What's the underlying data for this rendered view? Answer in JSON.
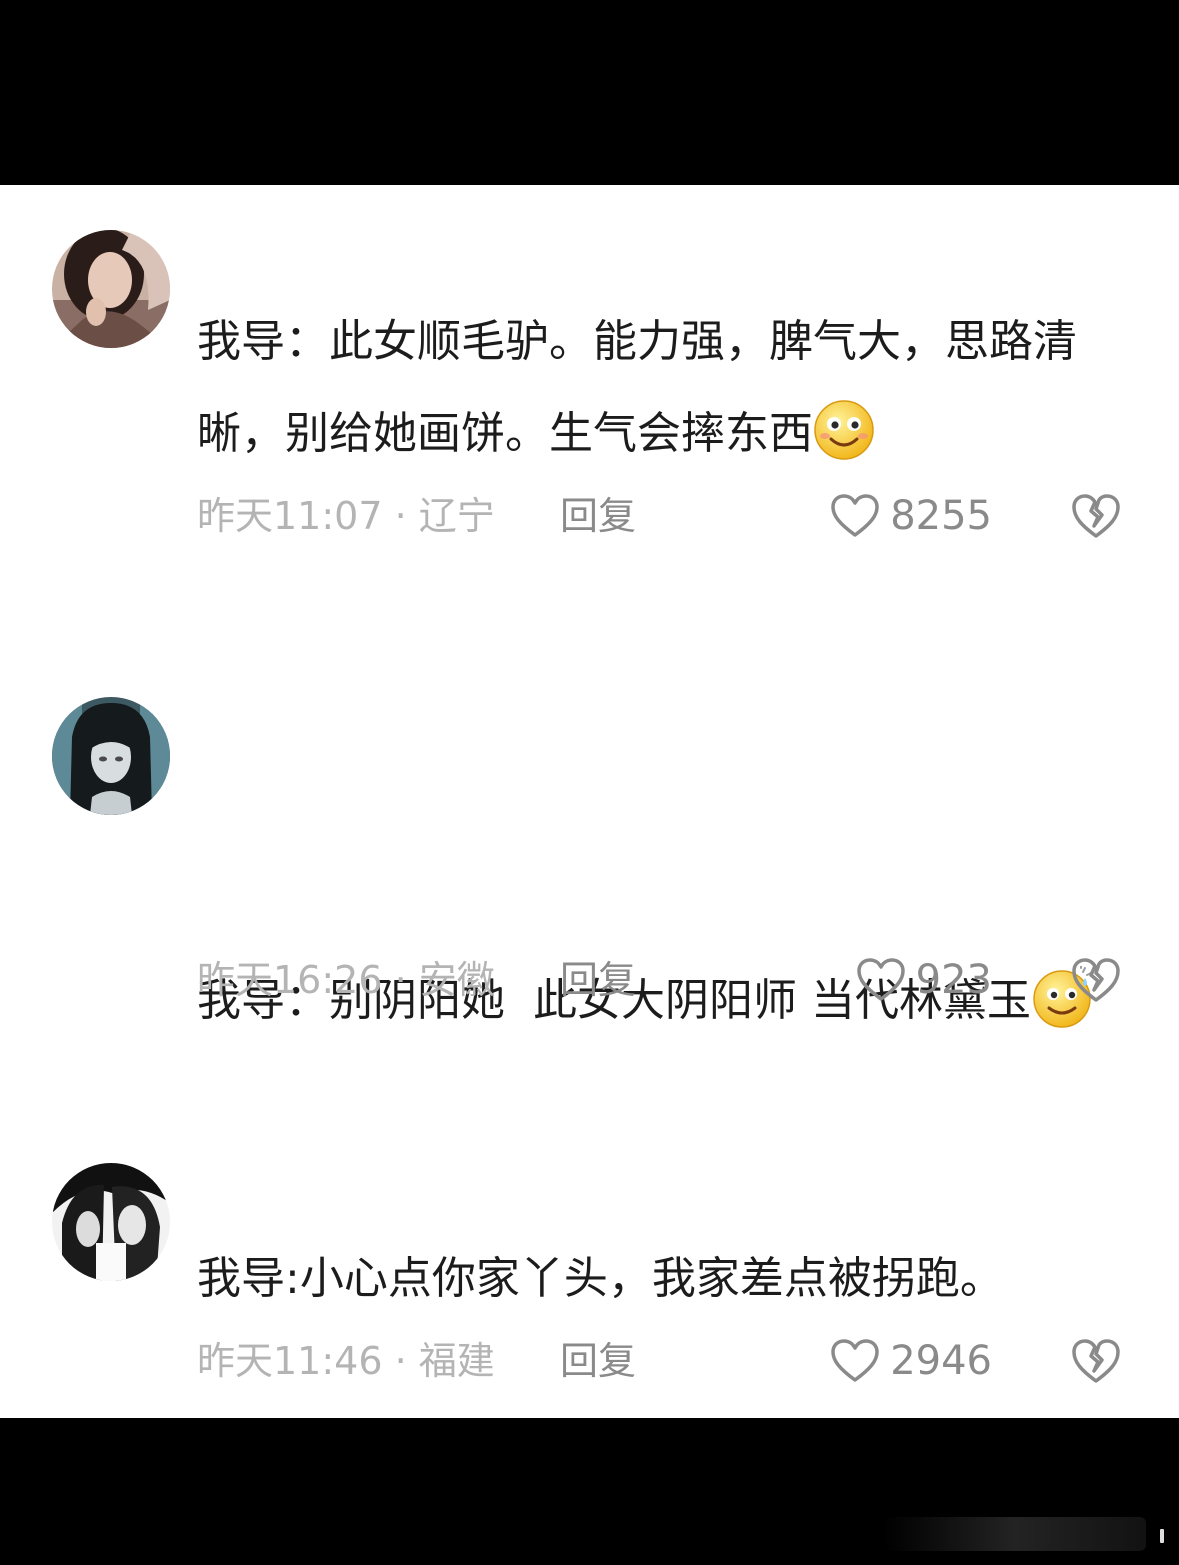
{
  "comments": [
    {
      "avatar": "avatar-woman-photo",
      "text_before_emoji": "我导：此女顺毛驴。能力强，脾气大，思路清晰，别给她画饼。生气会摔东西",
      "emoji": "smile-emoji",
      "time_location": "昨天11:07 · 辽宁",
      "reply_label": "回复",
      "like_count": "8255"
    },
    {
      "avatar": "avatar-anime-dark-hair",
      "text_before_emoji": "我导：别阴阳她  此女大阴阳师 当代林黛玉",
      "emoji": "sweat-smile-emoji",
      "time_location": "昨天16:26 · 安徽",
      "reply_label": "回复",
      "like_count": "923"
    },
    {
      "avatar": "avatar-anime-monochrome",
      "text_before_emoji": "我导:小心点你家丫头，我家差点被拐跑。",
      "emoji": "",
      "time_location": "昨天11:46 · 福建",
      "reply_label": "回复",
      "like_count": "2946"
    }
  ],
  "icons": {
    "like": "heart-outline-icon",
    "dislike": "broken-heart-icon"
  },
  "colors": {
    "text": "#1c1c1c",
    "meta": "#b4b4b4",
    "action": "#8a8a8a",
    "background": "#ffffff",
    "frame": "#000000"
  }
}
